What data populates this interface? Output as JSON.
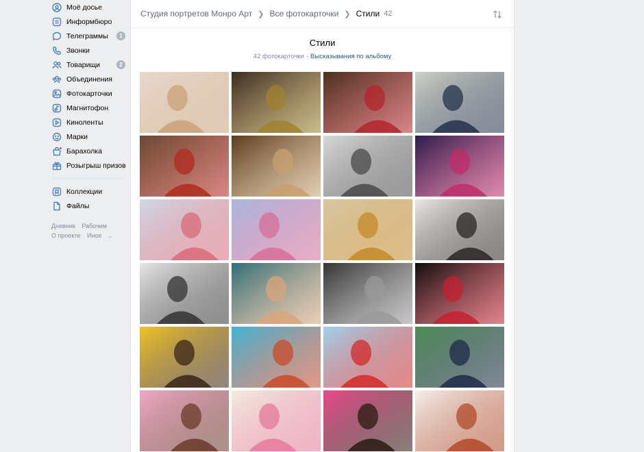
{
  "sidebar": {
    "items": [
      {
        "label": "Моё досье",
        "icon": "user-circle-icon"
      },
      {
        "label": "Информбюро",
        "icon": "newsfeed-icon"
      },
      {
        "label": "Телеграммы",
        "icon": "message-icon",
        "badge": "1"
      },
      {
        "label": "Звонки",
        "icon": "phone-icon"
      },
      {
        "label": "Товарищи",
        "icon": "friends-icon",
        "badge": "2"
      },
      {
        "label": "Объединения",
        "icon": "communities-icon"
      },
      {
        "label": "Фотокарточки",
        "icon": "photo-icon"
      },
      {
        "label": "Магнитофон",
        "icon": "music-icon"
      },
      {
        "label": "Киноленты",
        "icon": "video-icon"
      },
      {
        "label": "Марки",
        "icon": "stickers-icon"
      },
      {
        "label": "Барахолка",
        "icon": "market-icon"
      },
      {
        "label": "Розыгрыш призов",
        "icon": "gift-icon"
      }
    ],
    "items2": [
      {
        "label": "Коллекции",
        "icon": "bookmark-icon"
      },
      {
        "label": "Файлы",
        "icon": "file-icon"
      }
    ],
    "footer": {
      "blog": "Дневник",
      "dev": "Рабочим",
      "about": "О проекте",
      "more": "Иное"
    }
  },
  "breadcrumb": {
    "studio": "Студия портретов Монро Арт",
    "all_photos": "Все фотокарточки",
    "current": "Стили",
    "count": "42"
  },
  "album": {
    "title": "Стили",
    "count_text": "42 фотокарточки",
    "comments_link": "Высказывания по альбому"
  },
  "photos": [
    {
      "desc": "woman-in-straw-hat",
      "bg": "#e8d9cf",
      "fg": "#c9a27a"
    },
    {
      "desc": "couple-royal-costume",
      "bg": "#3b2c22",
      "fg": "#a0812f"
    },
    {
      "desc": "man-royal-robe",
      "bg": "#4a3220",
      "fg": "#b4242a"
    },
    {
      "desc": "officer-uniform-palace",
      "bg": "#cfd3c6",
      "fg": "#24314e"
    },
    {
      "desc": "general-red-uniform",
      "bg": "#6a4a34",
      "fg": "#b22a1f"
    },
    {
      "desc": "empress-portrait",
      "bg": "#5a3c1c",
      "fg": "#c8a070"
    },
    {
      "desc": "pencil-sketch-woman",
      "bg": "#d9d9d9",
      "fg": "#4a4a4a"
    },
    {
      "desc": "man-smoking-neon",
      "bg": "#2b1d4c",
      "fg": "#c12b6a"
    },
    {
      "desc": "marilyn-pop-art",
      "bg": "#cfd8e6",
      "fg": "#d96b7a"
    },
    {
      "desc": "couple-flowers",
      "bg": "#aab7e0",
      "fg": "#d76e98"
    },
    {
      "desc": "woman-yellow-top",
      "bg": "#d8c7a3",
      "fg": "#c48a2a"
    },
    {
      "desc": "woman-white-blazer",
      "bg": "#eae7e4",
      "fg": "#2a2624"
    },
    {
      "desc": "bw-woman-sketch",
      "bg": "#e6e6e6",
      "fg": "#333333"
    },
    {
      "desc": "blonde-woman-teal",
      "bg": "#2d6e78",
      "fg": "#d9a47a"
    },
    {
      "desc": "woman-profile-dark",
      "bg": "#353535",
      "fg": "#9a9a9a"
    },
    {
      "desc": "woman-black-red-lips",
      "bg": "#0e0e0e",
      "fg": "#c62030"
    },
    {
      "desc": "african-woman-turban",
      "bg": "#f2c425",
      "fg": "#3a2418"
    },
    {
      "desc": "man-glasses-popart",
      "bg": "#3fb6d8",
      "fg": "#c94a2a"
    },
    {
      "desc": "cartoon-family-football",
      "bg": "#9fd2ec",
      "fg": "#d22a2a"
    },
    {
      "desc": "cartoon-judge",
      "bg": "#4f8d57",
      "fg": "#1e2a48"
    },
    {
      "desc": "cartoon-makeup-woman",
      "bg": "#f0a8c8",
      "fg": "#6a3a2a"
    },
    {
      "desc": "cartoon-couple-sketch",
      "bg": "#f3ece0",
      "fg": "#e47a9a"
    },
    {
      "desc": "popart-collage-turban",
      "bg": "#e94a8a",
      "fg": "#2a1a12"
    },
    {
      "desc": "popart-collage-woman",
      "bg": "#f4f0ec",
      "fg": "#b04a2a"
    }
  ]
}
